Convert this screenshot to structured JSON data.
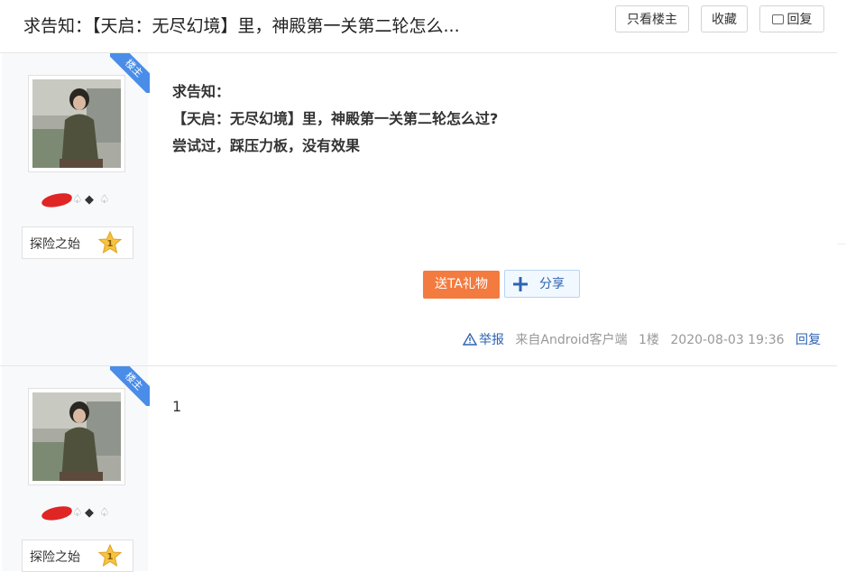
{
  "header": {
    "title": "求告知：【天启：无尽幻境】里，神殿第一关第二轮怎么...",
    "btn_only_owner": "只看楼主",
    "btn_favorite": "收藏",
    "btn_reply": "回复"
  },
  "posts": [
    {
      "ribbon": "楼主",
      "level_name": "探险之始",
      "level_num": "1",
      "badge_symbols": [
        "♤",
        "◆",
        "♤"
      ],
      "content_lines": [
        "求告知：",
        "【天启：无尽幻境】里，神殿第一关第二轮怎么过?",
        "尝试过，踩压力板，没有效果"
      ],
      "gift_label": "送TA礼物",
      "share_label": "分享",
      "report": "举报",
      "source": "来自Android客户端",
      "floor": "1楼",
      "time": "2020-08-03 19:36",
      "reply": "回复"
    },
    {
      "ribbon": "楼主",
      "level_name": "探险之始",
      "level_num": "1",
      "badge_symbols": [
        "♤",
        "◆",
        "♤"
      ],
      "content_lines": [
        "1"
      ]
    }
  ],
  "colors": {
    "accent_blue": "#2d64b3",
    "ribbon_blue": "#4a8de8",
    "gift_orange": "#f37b3f",
    "sidebar_bg": "#f8f9fb"
  }
}
